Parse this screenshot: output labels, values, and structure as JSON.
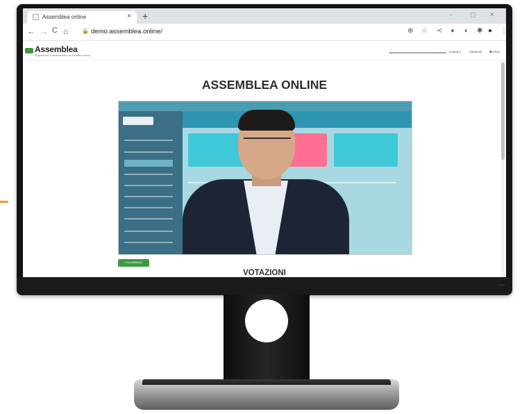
{
  "browser": {
    "tab_title": "Assemblea online",
    "tab_close": "×",
    "new_tab": "+",
    "url": "demo.assemblea.online/",
    "minimize": "−",
    "maximize": "▢",
    "close": "✕"
  },
  "nav": {
    "back": "←",
    "forward": "→",
    "reload": "C",
    "home": "⌂"
  },
  "toolbar_icons": [
    "zoom-icon",
    "star-icon",
    "extension-icon",
    "green-extension-icon",
    "extension-icon",
    "puzzle-icon",
    "profile-icon",
    "menu-icon"
  ],
  "site": {
    "logo_text": "Assemblea",
    "logo_tagline": "Registrazioni e trasformazioni dal bollettino veneto",
    "header_links": {
      "lingua": "Lingua ▾",
      "votazioni": "Votazioni",
      "aiuto": "❷ Aiuto"
    }
  },
  "main": {
    "page_title": "ASSEMBLEA ONLINE",
    "green_button": "Il tuo telefonico",
    "section_title": "VOTAZIONI"
  },
  "colors": {
    "accent_orange": "#f39a2b",
    "brand_green": "#3f9b3f",
    "video_teal": "#2f8fa6"
  }
}
